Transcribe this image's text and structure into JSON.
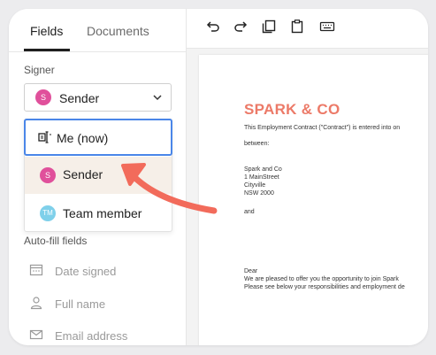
{
  "tabs": [
    {
      "label": "Fields",
      "active": true
    },
    {
      "label": "Documents",
      "active": false
    }
  ],
  "signer": {
    "section_label": "Signer",
    "selected": {
      "initials": "S",
      "label": "Sender"
    }
  },
  "dropdown": {
    "options": [
      {
        "label": "Me (now)",
        "icon": "signature-icon"
      },
      {
        "label": "Sender",
        "initials": "S"
      },
      {
        "label": "Team member",
        "initials": "TM"
      }
    ]
  },
  "autofill": {
    "section_label": "Auto-fill fields",
    "items": [
      {
        "label": "Date signed",
        "icon": "calendar-icon"
      },
      {
        "label": "Full name",
        "icon": "person-icon"
      },
      {
        "label": "Email address",
        "icon": "envelope-icon"
      }
    ]
  },
  "toolbar": {
    "tools": [
      "undo-icon",
      "redo-icon",
      "copy-icon",
      "paste-icon",
      "keyboard-icon"
    ]
  },
  "document": {
    "title": "SPARK & CO",
    "lines": [
      "This Employment Contract (\"Contract\") is entered into on",
      "between:",
      "Spark and Co",
      "1 MainStreet",
      "Cityville",
      "NSW 2000",
      "and",
      "Dear",
      "We are pleased to offer you the opportunity to join Spark",
      "Please see below your responsibilities and employment de"
    ]
  },
  "colors": {
    "accent_blue": "#4a86e8",
    "sender_pink": "#e0509b",
    "team_cyan": "#7fd0ea",
    "title_coral": "#ec7a68",
    "arrow_coral": "#f26b5b"
  }
}
